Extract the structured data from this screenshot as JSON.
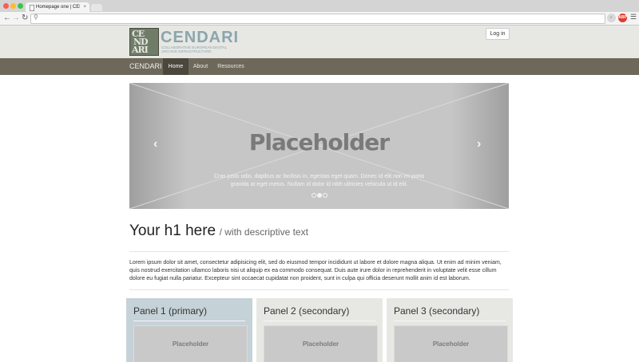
{
  "browser": {
    "tab_title": "Homepage one | CENDARI",
    "tab_close": "×",
    "address": ""
  },
  "header": {
    "logo_letters": [
      "CE",
      "ND",
      "ARI"
    ],
    "logo_word": "CENDARI",
    "logo_tagline": "Collaborative European Digital Archive Infrastructure",
    "login_label": "Log in"
  },
  "nav": {
    "brand": "CENDARI",
    "items": [
      "Home",
      "About",
      "Resources"
    ]
  },
  "carousel": {
    "title": "Placeholder",
    "caption": "Cras justo odio, dapibus ac facilisis in, egestas eget quam. Donec id elit non mi porta gravida at eget metus. Nullam id dolor id nibh ultricies vehicula ut id elit.",
    "prev": "‹",
    "next": "›",
    "slide_count": 3,
    "active_slide": 2
  },
  "intro": {
    "heading": "Your h1 here",
    "subheading": "/ with descriptive text",
    "lead": "Lorem ipsum dolor sit amet, consectetur adipisicing elit, sed do eiusmod tempor incididunt ut labore et dolore magna aliqua. Ut enim ad minim veniam, quis nostrud exercitation ullamco laboris nisi ut aliquip ex ea commodo consequat. Duis aute irure dolor in reprehenderit in voluptate velit esse cillum dolore eu fugiat nulla pariatur. Excepteur sint occaecat cupidatat non proident, sunt in culpa qui officia deserunt mollit anim id est laborum."
  },
  "panels": [
    {
      "title": "Panel 1 (primary)",
      "placeholder": "Placeholder"
    },
    {
      "title": "Panel 2 (secondary)",
      "placeholder": "Placeholder"
    },
    {
      "title": "Panel 3 (secondary)",
      "placeholder": "Placeholder"
    }
  ],
  "colors": {
    "nav_bg": "#6d6859",
    "nav_active": "#4b473c",
    "header_bg": "#e7e7e3",
    "brand_accent": "#8aa5ad",
    "panel_primary": "#c5d2d8"
  }
}
